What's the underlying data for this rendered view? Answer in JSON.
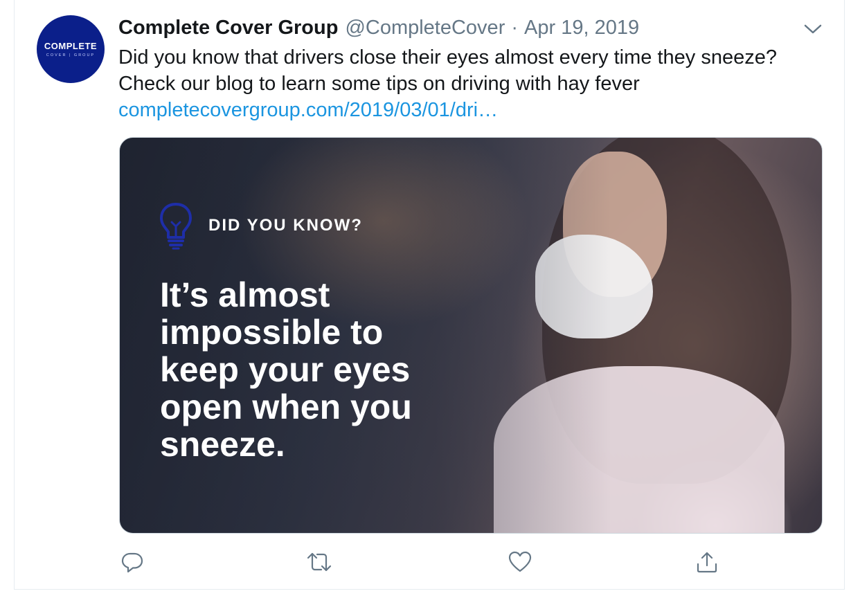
{
  "tweet": {
    "avatar": {
      "brand_line1": "COMPLETE",
      "brand_line2": "COVER | GROUP",
      "color": "#0b1f8a"
    },
    "display_name": "Complete Cover Group",
    "handle": "@CompleteCover",
    "separator": "·",
    "date": "Apr 19, 2019",
    "text_line1": "Did you know that drivers close their eyes almost every time they sneeze?",
    "text_line2": "Check our blog to learn some tips on driving with hay fever",
    "link_text": "completecovergroup.com/2019/03/01/dri…",
    "link_color": "#1b95e0",
    "media": {
      "eyebrow": "DID YOU KNOW?",
      "headline_lines": [
        "It’s almost",
        "impossible to",
        "keep your eyes",
        "open when you",
        "sneeze."
      ],
      "bulb_icon": "lightbulb-icon"
    },
    "actions": [
      {
        "name": "reply",
        "icon": "reply-icon"
      },
      {
        "name": "retweet",
        "icon": "retweet-icon"
      },
      {
        "name": "like",
        "icon": "heart-icon"
      },
      {
        "name": "share",
        "icon": "share-icon"
      }
    ]
  }
}
